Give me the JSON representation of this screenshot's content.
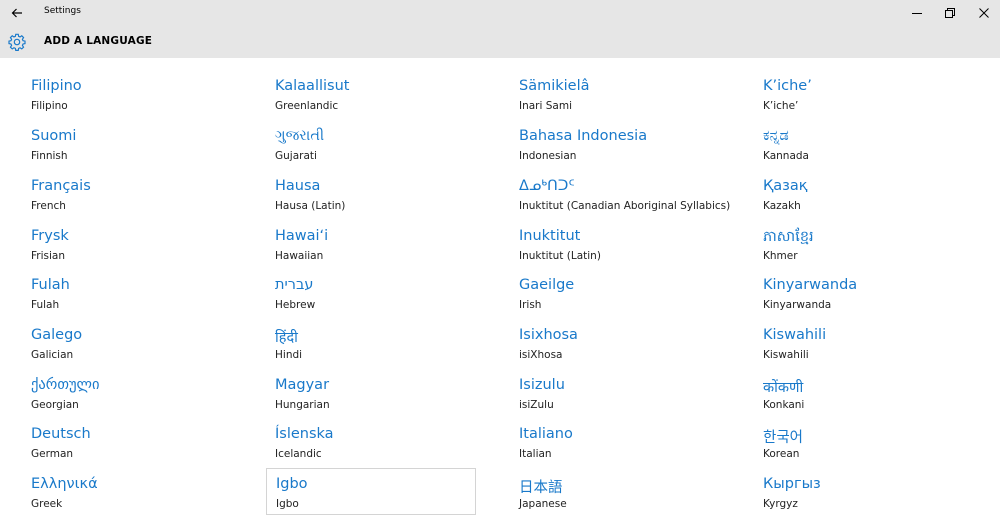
{
  "window": {
    "title": "Settings",
    "back_icon": "arrow-left-icon",
    "minimize_icon": "minimize-icon",
    "maximize_icon": "restore-icon",
    "close_icon": "close-icon"
  },
  "header": {
    "icon": "gear-icon",
    "title": "ADD A LANGUAGE"
  },
  "colors": {
    "accent": "#1979ca",
    "chrome": "#e6e6e6"
  },
  "columns": [
    {
      "items": [
        {
          "native": "Filipino",
          "english": "Filipino"
        },
        {
          "native": "Suomi",
          "english": "Finnish"
        },
        {
          "native": "Français",
          "english": "French"
        },
        {
          "native": "Frysk",
          "english": "Frisian"
        },
        {
          "native": "Fulah",
          "english": "Fulah"
        },
        {
          "native": "Galego",
          "english": "Galician"
        },
        {
          "native": "ქართული",
          "english": "Georgian"
        },
        {
          "native": "Deutsch",
          "english": "German"
        },
        {
          "native": "Ελληνικά",
          "english": "Greek"
        }
      ]
    },
    {
      "items": [
        {
          "native": "Kalaallisut",
          "english": "Greenlandic"
        },
        {
          "native": "ગુજરાતી",
          "english": "Gujarati"
        },
        {
          "native": "Hausa",
          "english": "Hausa (Latin)"
        },
        {
          "native": "Hawaiʻi",
          "english": "Hawaiian"
        },
        {
          "native": "עברית",
          "english": "Hebrew"
        },
        {
          "native": "हिंदी",
          "english": "Hindi"
        },
        {
          "native": "Magyar",
          "english": "Hungarian"
        },
        {
          "native": "Íslenska",
          "english": "Icelandic"
        },
        {
          "native": "Igbo",
          "english": "Igbo",
          "selected": true
        }
      ]
    },
    {
      "items": [
        {
          "native": "Sämikielâ",
          "english": "Inari Sami"
        },
        {
          "native": "Bahasa Indonesia",
          "english": "Indonesian"
        },
        {
          "native": "ᐃᓄᒃᑎᑐᑦ",
          "english": "Inuktitut (Canadian Aboriginal Syllabics)"
        },
        {
          "native": "Inuktitut",
          "english": "Inuktitut (Latin)"
        },
        {
          "native": "Gaeilge",
          "english": "Irish"
        },
        {
          "native": "Isixhosa",
          "english": "isiXhosa"
        },
        {
          "native": "Isizulu",
          "english": "isiZulu"
        },
        {
          "native": "Italiano",
          "english": "Italian"
        },
        {
          "native": "日本語",
          "english": "Japanese"
        }
      ]
    },
    {
      "items": [
        {
          "native": "K’iche’",
          "english": "K’iche’"
        },
        {
          "native": "ಕನ್ನಡ",
          "english": "Kannada"
        },
        {
          "native": "Қазақ",
          "english": "Kazakh"
        },
        {
          "native": "ភាសាខ្មែរ",
          "english": "Khmer"
        },
        {
          "native": "Kinyarwanda",
          "english": "Kinyarwanda"
        },
        {
          "native": "Kiswahili",
          "english": "Kiswahili"
        },
        {
          "native": "कोंकणी",
          "english": "Konkani"
        },
        {
          "native": "한국어",
          "english": "Korean"
        },
        {
          "native": "Кыргыз",
          "english": "Kyrgyz"
        }
      ]
    }
  ]
}
